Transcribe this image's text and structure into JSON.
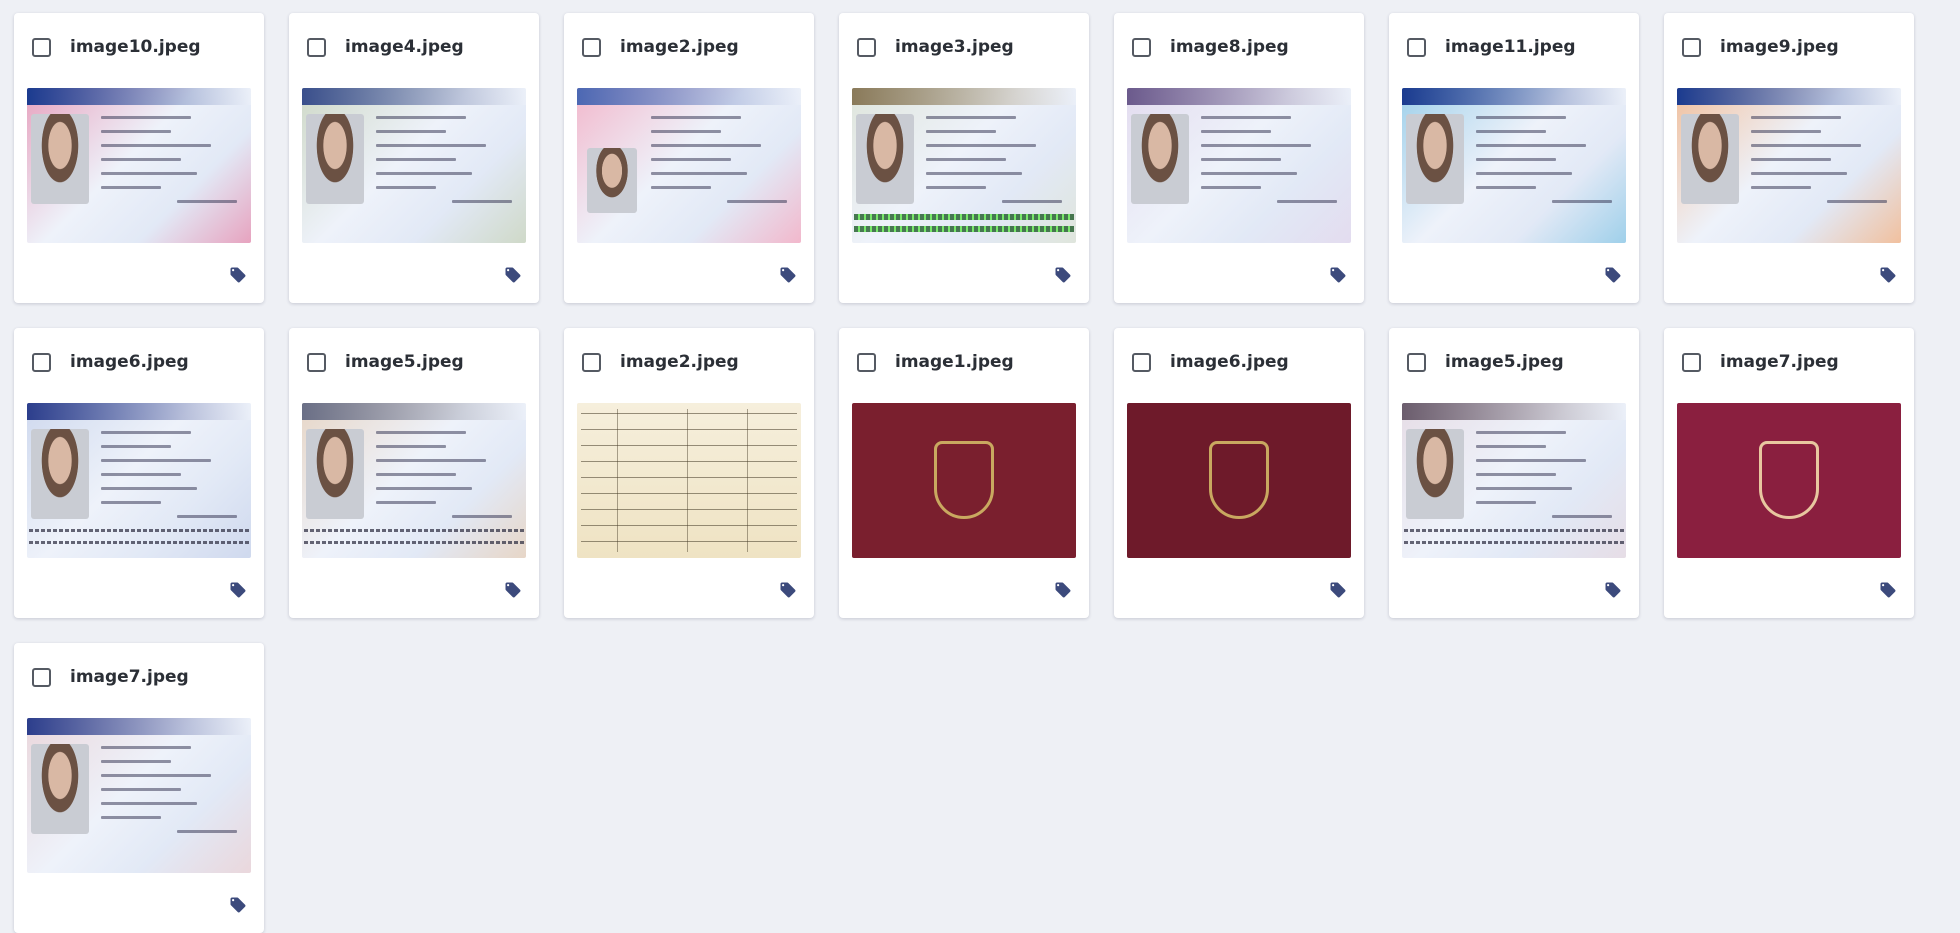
{
  "cards": [
    {
      "filename": "image10.jpeg",
      "thumb": "id-card",
      "accent": "#e7a3bf",
      "band": "#1b3b8f"
    },
    {
      "filename": "image4.jpeg",
      "thumb": "id-card",
      "accent": "#cfd9c8",
      "band": "#3a4f8c"
    },
    {
      "filename": "image2.jpeg",
      "thumb": "driving-licence",
      "accent": "#f2b8cc",
      "band": "#4c68b3"
    },
    {
      "filename": "image3.jpeg",
      "thumb": "id-card-mrz-green",
      "accent": "#dfe5dc",
      "band": "#8a7a5a"
    },
    {
      "filename": "image8.jpeg",
      "thumb": "id-card",
      "accent": "#e3dcef",
      "band": "#6b5a8c"
    },
    {
      "filename": "image11.jpeg",
      "thumb": "id-card",
      "accent": "#9fd0ea",
      "band": "#1b3b8f"
    },
    {
      "filename": "image9.jpeg",
      "thumb": "id-card",
      "accent": "#f1c09e",
      "band": "#1b3b8f"
    },
    {
      "filename": "image6.jpeg",
      "thumb": "passport-data-page",
      "accent": "#cfd9ee",
      "band": "#2c3e8c"
    },
    {
      "filename": "image5.jpeg",
      "thumb": "passport-data-page",
      "accent": "#e7d6c7",
      "band": "#6a6f86"
    },
    {
      "filename": "image2.jpeg",
      "thumb": "document",
      "accent": "#efe3c3",
      "band": "#6b5b3b"
    },
    {
      "filename": "image1.jpeg",
      "thumb": "passport-cover",
      "accent": "#7a1f2e",
      "band": "#c9a860"
    },
    {
      "filename": "image6.jpeg",
      "thumb": "passport-cover",
      "accent": "#6e1a2a",
      "band": "#c9a860"
    },
    {
      "filename": "image5.jpeg",
      "thumb": "passport-data-page",
      "accent": "#e6dde6",
      "band": "#6b5d6d"
    },
    {
      "filename": "image7.jpeg",
      "thumb": "passport-cover",
      "accent": "#8a1f3f",
      "band": "#e8c7a0"
    },
    {
      "filename": "image7.jpeg",
      "thumb": "id-card",
      "accent": "#ead7dc",
      "band": "#2c3e8c"
    }
  ],
  "icons": {
    "checkbox": "checkbox-empty",
    "tag": "tag-icon"
  },
  "colors": {
    "background": "#eef0f5",
    "card": "#ffffff",
    "tag": "#3c4a7c",
    "checkbox_border": "#555a63"
  }
}
